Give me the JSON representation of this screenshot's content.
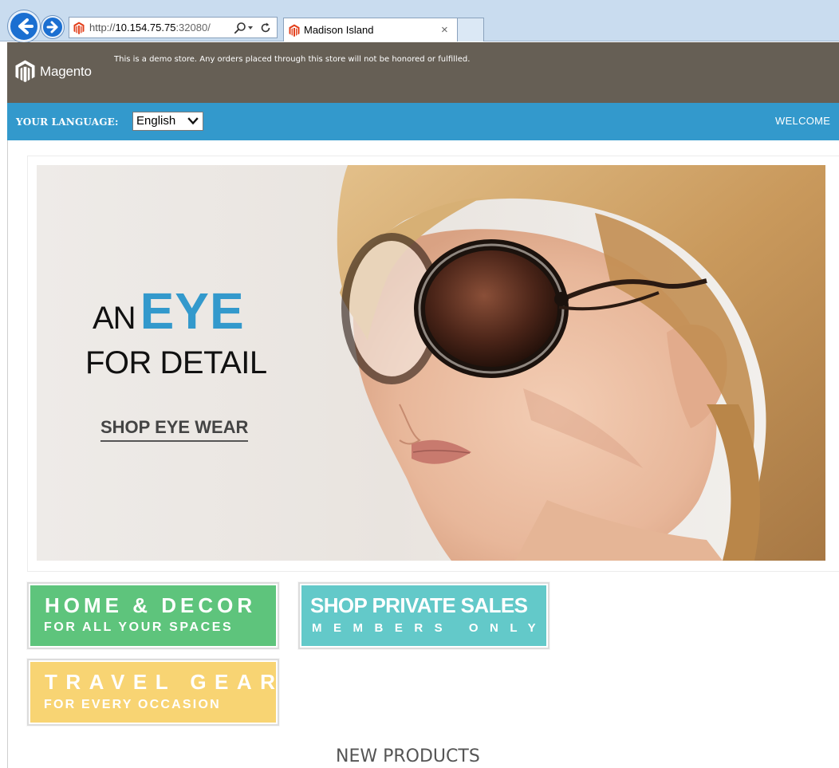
{
  "browser": {
    "url_prefix": "http://",
    "url_host": "10.154.75.75",
    "url_port": ":32080/",
    "tab_title": "Madison Island",
    "tab_close": "×"
  },
  "header": {
    "logo_text": "Magento",
    "demo_notice": "This is a demo store. Any orders placed through this store will not be honored or fulfilled."
  },
  "language_bar": {
    "label": "YOUR LANGUAGE:",
    "selected_language": "English",
    "welcome": "WELCOME"
  },
  "hero": {
    "line1_a": "AN",
    "line1_b": "EYE",
    "line2": "FOR DETAIL",
    "cta": "SHOP EYE WEAR"
  },
  "promos": [
    {
      "title": "HOME & DECOR",
      "subtitle": "FOR ALL YOUR SPACES",
      "color": "#5ec47c"
    },
    {
      "title": "SHOP PRIVATE SALES",
      "subtitle": "MEMBERS ONLY",
      "color": "#63c9c9"
    },
    {
      "title": "TRAVEL GEAR",
      "subtitle": "FOR EVERY OCCASION",
      "color": "#f8d473"
    }
  ],
  "sections": {
    "new_products": "NEW PRODUCTS"
  },
  "colors": {
    "accent_blue": "#3399cc",
    "demo_bar": "#665f55",
    "browser_chrome": "#c9dcef"
  }
}
